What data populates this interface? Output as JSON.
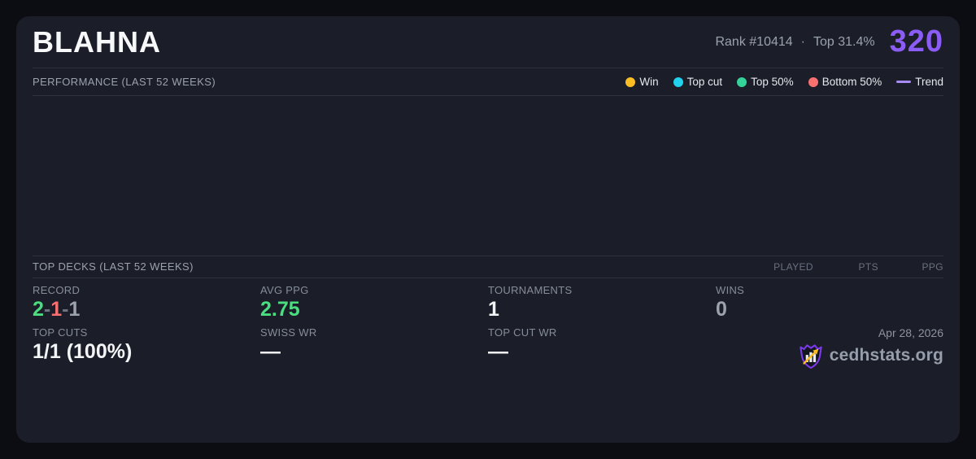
{
  "colors": {
    "accent_purple": "#8b5cf6",
    "green": "#4ade80",
    "red": "#f87171",
    "neutral_gray": "#9ca3af"
  },
  "header": {
    "title": "BLAHNA",
    "rank": "Rank #10414",
    "dot_separator": "·",
    "top_percent": "Top 31.4%",
    "score": "320"
  },
  "performance": {
    "section_title": "PERFORMANCE (LAST 52 WEEKS)",
    "legend": [
      {
        "label": "Win",
        "color": "#fbbf24"
      },
      {
        "label": "Top cut",
        "color": "#22d3ee"
      },
      {
        "label": "Top 50%",
        "color": "#34d399"
      },
      {
        "label": "Bottom 50%",
        "color": "#f87171"
      },
      {
        "label": "Trend",
        "color": "#a78bfa"
      }
    ],
    "chart_points": []
  },
  "top_decks": {
    "section_title": "TOP DECKS (LAST 52 WEEKS)",
    "columns": [
      "PLAYED",
      "PTS",
      "PPG"
    ],
    "rows": []
  },
  "stats": {
    "record": {
      "label": "RECORD",
      "wins": "2",
      "losses": "1",
      "draws": "1",
      "dash": "-"
    },
    "avg_ppg": {
      "label": "AVG PPG",
      "value": "2.75"
    },
    "tournaments": {
      "label": "TOURNAMENTS",
      "value": "1"
    },
    "wins": {
      "label": "WINS",
      "value": "0"
    },
    "top_cuts": {
      "label": "TOP CUTS",
      "value": "1/1 (100%)"
    },
    "swiss_wr": {
      "label": "SWISS WR",
      "value": "—"
    },
    "top_cut_wr": {
      "label": "TOP CUT WR",
      "value": "—"
    }
  },
  "footer": {
    "date": "Apr 28, 2026",
    "brand": "cedhstats.org"
  }
}
